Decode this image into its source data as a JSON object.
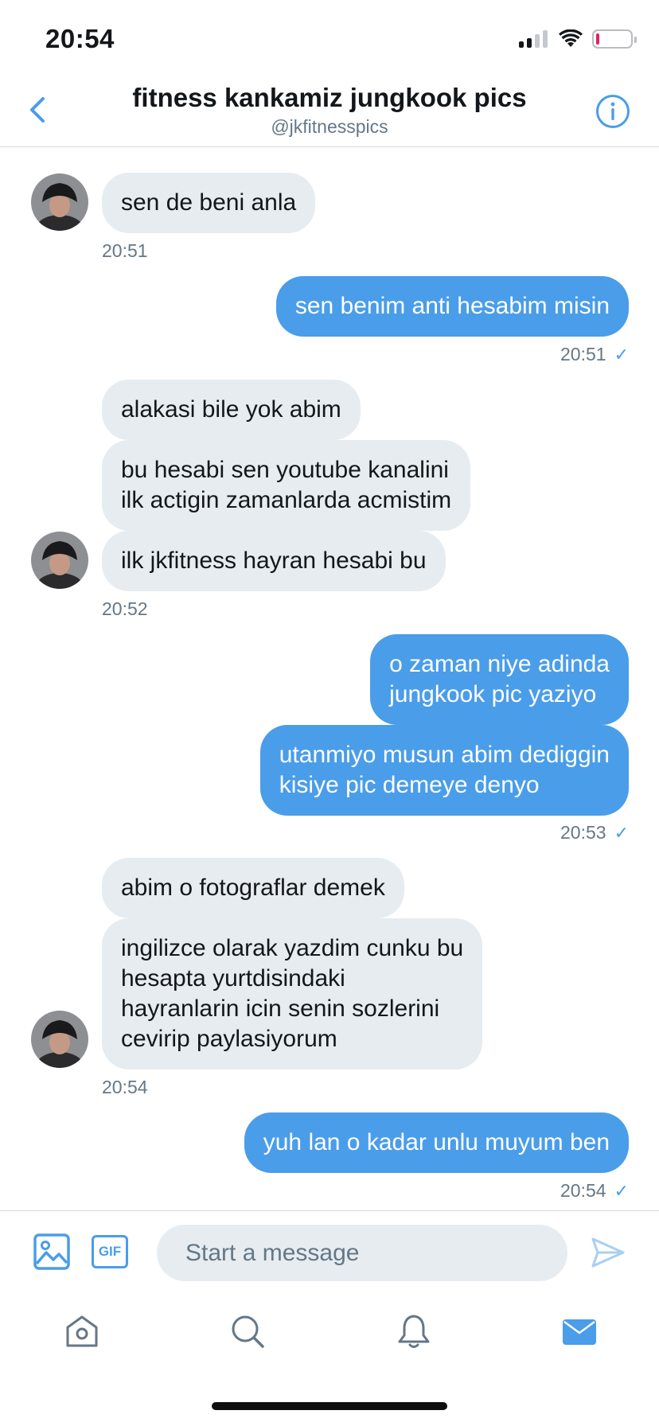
{
  "status_bar": {
    "time": "20:54"
  },
  "header": {
    "title": "fitness kankamiz jungkook pics",
    "handle": "@jkfitnesspics",
    "accent_color": "#4a9de9"
  },
  "messages": [
    {
      "dir": "in",
      "text": "sen de beni anla"
    },
    {
      "dir": "in_time",
      "text": "20:51"
    },
    {
      "dir": "out",
      "text": "sen benim anti hesabim misin"
    },
    {
      "dir": "out_time",
      "text": "20:51"
    },
    {
      "dir": "in",
      "text": "alakasi bile yok abim"
    },
    {
      "dir": "in",
      "text": "bu hesabi sen youtube kanalini\nilk actigin zamanlarda acmistim"
    },
    {
      "dir": "in",
      "text": "ilk jkfitness hayran hesabi bu"
    },
    {
      "dir": "in_time",
      "text": "20:52"
    },
    {
      "dir": "out",
      "text": "o zaman niye adinda\njungkook pic yaziyo"
    },
    {
      "dir": "out",
      "text": "utanmiyo musun abim dediggin\nkisiye pic demeye denyo"
    },
    {
      "dir": "out_time",
      "text": "20:53"
    },
    {
      "dir": "in",
      "text": "abim o fotograflar demek"
    },
    {
      "dir": "in",
      "text": "ingilizce olarak yazdim cunku bu\nhesapta yurtdisindaki\nhayranlarin icin senin sozlerini\ncevirip paylasiyorum"
    },
    {
      "dir": "in_time",
      "text": "20:54"
    },
    {
      "dir": "out",
      "text": "yuh lan o kadar unlu muyum ben"
    },
    {
      "dir": "out_time",
      "text": "20:54"
    }
  ],
  "composer": {
    "placeholder": "Start a message",
    "gif_label": "GIF"
  },
  "tabs": [
    {
      "icon": "home-icon",
      "active": false
    },
    {
      "icon": "search-icon",
      "active": false
    },
    {
      "icon": "bell-icon",
      "active": false
    },
    {
      "icon": "mail-icon",
      "active": true
    }
  ]
}
